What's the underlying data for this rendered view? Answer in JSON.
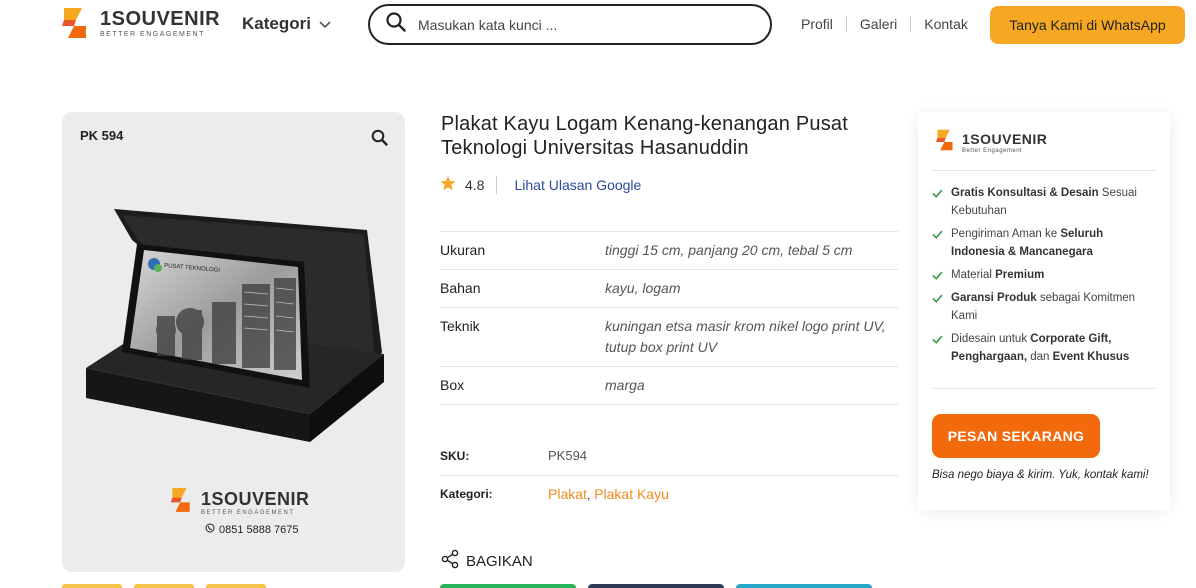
{
  "header": {
    "logo_brand": "1SOUVENIR",
    "logo_tagline": "BETTER ENGAGEMENT",
    "kategori_label": "Kategori",
    "search_placeholder": "Masukan kata kunci ...",
    "nav": [
      "Profil",
      "Galeri",
      "Kontak"
    ],
    "whatsapp_label": "Tanya Kami di WhatsApp"
  },
  "gallery": {
    "code": "PK 594",
    "plaque_text": "PUSAT TEKNOLOGI",
    "logo_brand": "1SOUVENIR",
    "logo_tagline": "BETTER ENGAGEMENT",
    "phone": "0851 5888 7675"
  },
  "product": {
    "title": "Plakat Kayu Logam Kenang-kenangan Pusat Teknologi Universitas Hasanuddin",
    "rating": "4.8",
    "reviews_link": "Lihat Ulasan Google",
    "specs": [
      {
        "label": "Ukuran",
        "value": "tinggi 15 cm, panjang 20 cm, tebal 5 cm"
      },
      {
        "label": "Bahan",
        "value": "kayu, logam"
      },
      {
        "label": "Teknik",
        "value": "kuningan etsa masir krom nikel logo print UV, tutup box print UV"
      },
      {
        "label": "Box",
        "value": "marga"
      }
    ],
    "sku_label": "SKU:",
    "sku_value": "PK594",
    "category_label": "Kategori:",
    "categories": [
      "Plakat",
      "Plakat Kayu"
    ],
    "category_separator": ",",
    "share_label": "BAGIKAN"
  },
  "sidebar": {
    "logo_brand": "1SOUVENIR",
    "logo_tagline": "Better Engagement",
    "features": [
      [
        {
          "t": "Gratis Konsultasi & Desain",
          "b": true
        },
        {
          "t": " Sesuai Kebutuhan",
          "b": false
        }
      ],
      [
        {
          "t": "Pengiriman Aman ke ",
          "b": false
        },
        {
          "t": "Seluruh Indonesia & Mancanegara",
          "b": true
        }
      ],
      [
        {
          "t": "Material ",
          "b": false
        },
        {
          "t": "Premium",
          "b": true
        }
      ],
      [
        {
          "t": "Garansi Produk",
          "b": true
        },
        {
          "t": " sebagai Komitmen Kami",
          "b": false
        }
      ],
      [
        {
          "t": "Didesain untuk ",
          "b": false
        },
        {
          "t": "Corporate Gift, Penghargaan,",
          "b": true
        },
        {
          "t": " dan ",
          "b": false
        },
        {
          "t": "Event Khusus",
          "b": true
        }
      ]
    ],
    "order_button": "PESAN SEKARANG",
    "nego_text": "Bisa nego biaya & kirim. Yuk, kontak kami!"
  },
  "colors": {
    "accent_orange": "#f36a0d",
    "whatsapp_yellow": "#f7a823",
    "link_blue": "#2c4a9c",
    "check_green": "#3a9a4a",
    "star": "#f5a623"
  },
  "icons": [
    "search-icon",
    "chevron-down-icon",
    "zoom-icon",
    "star-icon",
    "check-icon",
    "share-icon",
    "whatsapp-icon"
  ]
}
